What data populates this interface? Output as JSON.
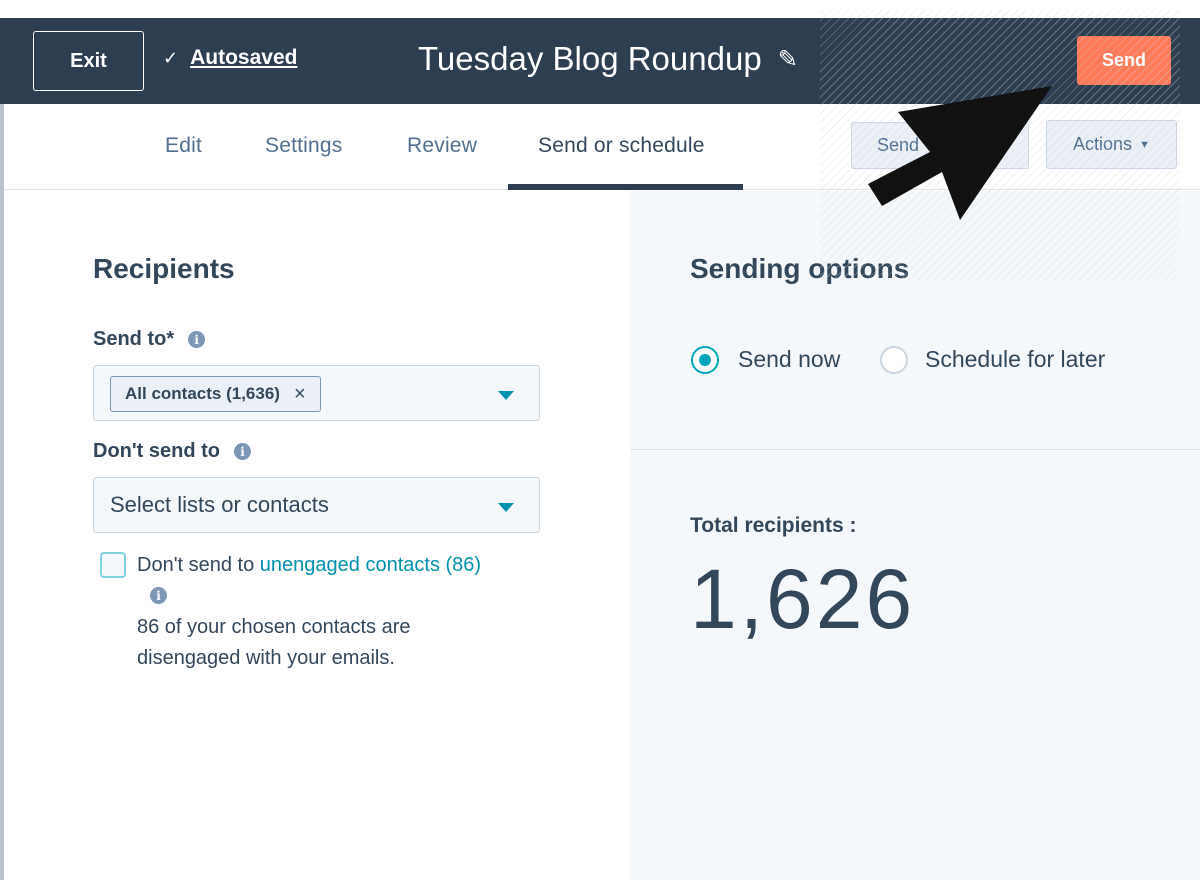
{
  "header": {
    "exit_label": "Exit",
    "autosave_label": "Autosaved",
    "title": "Tuesday Blog Roundup",
    "send_label": "Send",
    "colors": {
      "bar": "#2d3e50",
      "send": "#ff7a59"
    }
  },
  "tabs": [
    {
      "label": "Edit"
    },
    {
      "label": "Settings"
    },
    {
      "label": "Review"
    },
    {
      "label": "Send or schedule",
      "active": true
    }
  ],
  "toolbar": {
    "send_test_label": "Send",
    "actions_label": "Actions"
  },
  "recipients": {
    "title": "Recipients",
    "send_to_label": "Send to*",
    "send_to_tag": "All contacts (1,636)",
    "dont_send_label": "Don't send to",
    "dont_send_placeholder": "Select lists or contacts",
    "unengaged_prefix": "Don't send to ",
    "unengaged_link": "unengaged contacts (86)",
    "unengaged_note_line1": "86 of your chosen contacts are",
    "unengaged_note_line2": "disengaged with your emails."
  },
  "sending_options": {
    "title": "Sending options",
    "options": [
      {
        "label": "Send now",
        "checked": true
      },
      {
        "label": "Schedule for later",
        "checked": false
      }
    ],
    "total_label": "Total recipients :",
    "total_value": "1,626"
  },
  "icons": {
    "check": "check-icon",
    "pencil": "pencil-icon",
    "info": "info-icon",
    "caret": "caret-down-icon",
    "close": "close-icon",
    "pointer": "pointer-arrow-icon"
  }
}
